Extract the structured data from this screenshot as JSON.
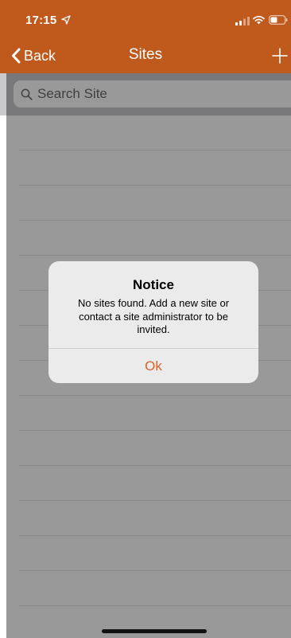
{
  "status_bar": {
    "time": "17:15",
    "icons": [
      "location-arrow-icon",
      "signal-icon",
      "wifi-icon",
      "battery-icon"
    ]
  },
  "nav": {
    "back_label": "Back",
    "title": "Sites",
    "add_icon": "plus-icon"
  },
  "search": {
    "placeholder": "Search Site",
    "icon": "search-icon"
  },
  "alert": {
    "title": "Notice",
    "message": "No sites found. Add a new site or contact a site administrator to be invited.",
    "button_label": "Ok"
  },
  "colors": {
    "brand": "#c0591c",
    "alert_button": "#d9602a",
    "search_bar_bg": "#c9c9ce"
  }
}
